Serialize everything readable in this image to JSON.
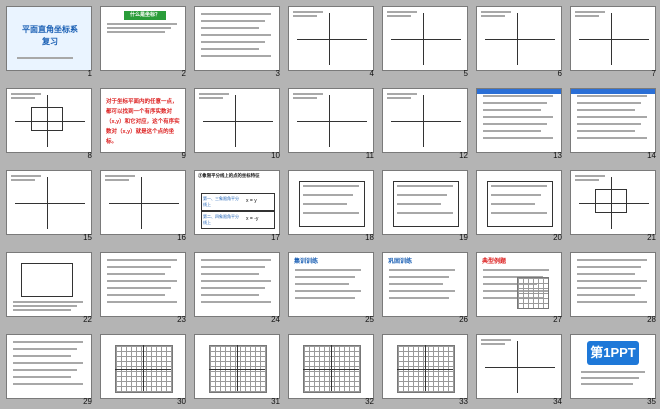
{
  "slide1": {
    "title_line1": "平面直角坐标系",
    "title_line2": "复习"
  },
  "slide2": {
    "banner": "什么是坐标？"
  },
  "slide9": {
    "text": "对于坐标平面内的任意一点，都可以找到一个有序实数对（x,y）和它对应，这个有序实数对（x,y）就是这个点的坐标。"
  },
  "slide17": {
    "heading": "③象限平分线上的点的坐标特征",
    "rows": [
      "第一、三象限角平分线上",
      "第二、四象限角平分线上"
    ],
    "values": [
      "x = y",
      "x = -y"
    ]
  },
  "slide25": {
    "title": "集训训练"
  },
  "slide26": {
    "title": "巩固训练"
  },
  "slide27": {
    "title": "典型例题"
  },
  "slide35": {
    "logo": "第1PPT"
  },
  "slides": [
    {
      "n": "1"
    },
    {
      "n": "2"
    },
    {
      "n": "3"
    },
    {
      "n": "4"
    },
    {
      "n": "5"
    },
    {
      "n": "6"
    },
    {
      "n": "7"
    },
    {
      "n": "8"
    },
    {
      "n": "9"
    },
    {
      "n": "10"
    },
    {
      "n": "11"
    },
    {
      "n": "12"
    },
    {
      "n": "13"
    },
    {
      "n": "14"
    },
    {
      "n": "15"
    },
    {
      "n": "16"
    },
    {
      "n": "17"
    },
    {
      "n": "18"
    },
    {
      "n": "19"
    },
    {
      "n": "20"
    },
    {
      "n": "21"
    },
    {
      "n": "22"
    },
    {
      "n": "23"
    },
    {
      "n": "24"
    },
    {
      "n": "25"
    },
    {
      "n": "26"
    },
    {
      "n": "27"
    },
    {
      "n": "28"
    },
    {
      "n": "29"
    },
    {
      "n": "30"
    },
    {
      "n": "31"
    },
    {
      "n": "32"
    },
    {
      "n": "33"
    },
    {
      "n": "34"
    },
    {
      "n": "35"
    }
  ]
}
